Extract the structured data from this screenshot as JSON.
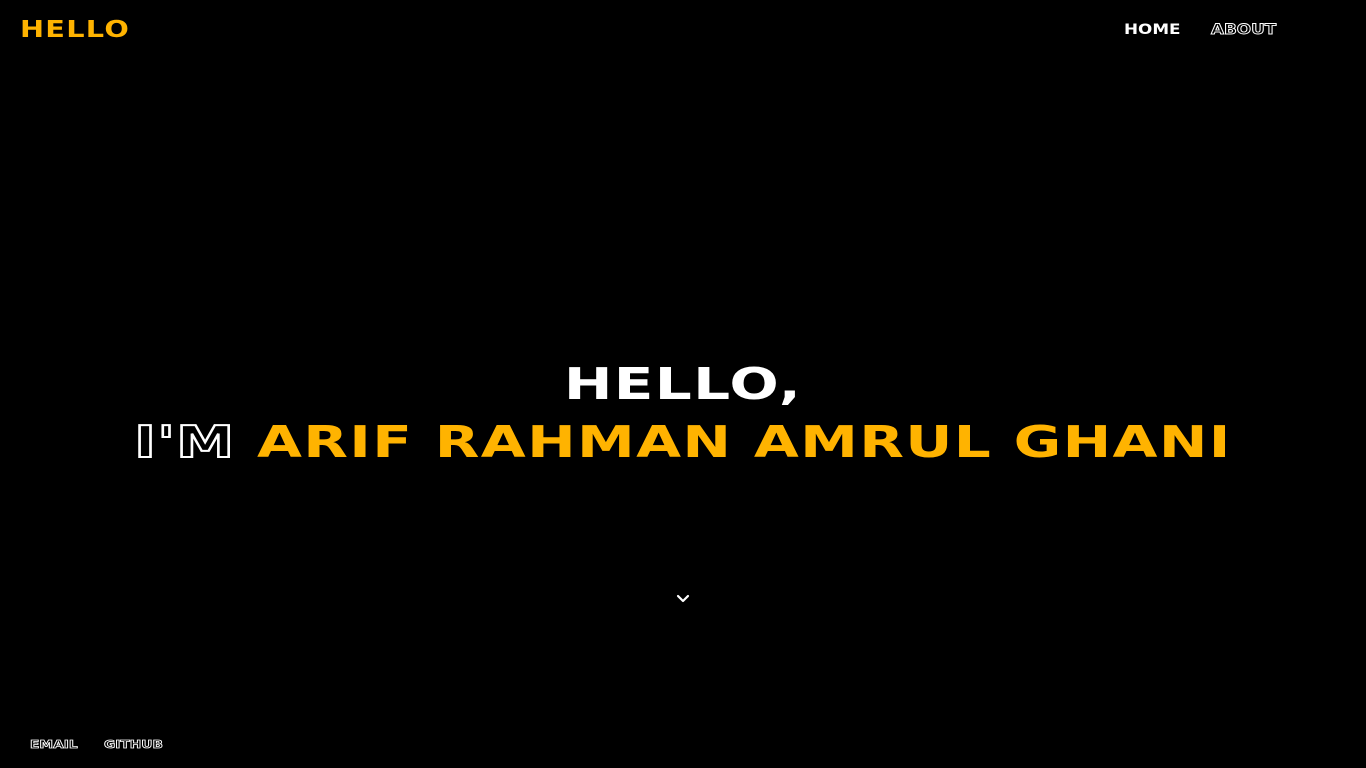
{
  "header": {
    "logo": "HELLO",
    "nav": {
      "home": "HOME",
      "about": "ABOUT"
    }
  },
  "hero": {
    "greeting": "HELLO,",
    "intro": "I'M",
    "name": "ARIF RAHMAN AMRUL GHANI"
  },
  "scroll": {
    "icon": "chevron-down-icon"
  },
  "footer": {
    "email": "EMAIL",
    "github": "GITHUB"
  },
  "colors": {
    "background": "#000000",
    "accent": "#FFB300",
    "text": "#FFFFFF"
  }
}
